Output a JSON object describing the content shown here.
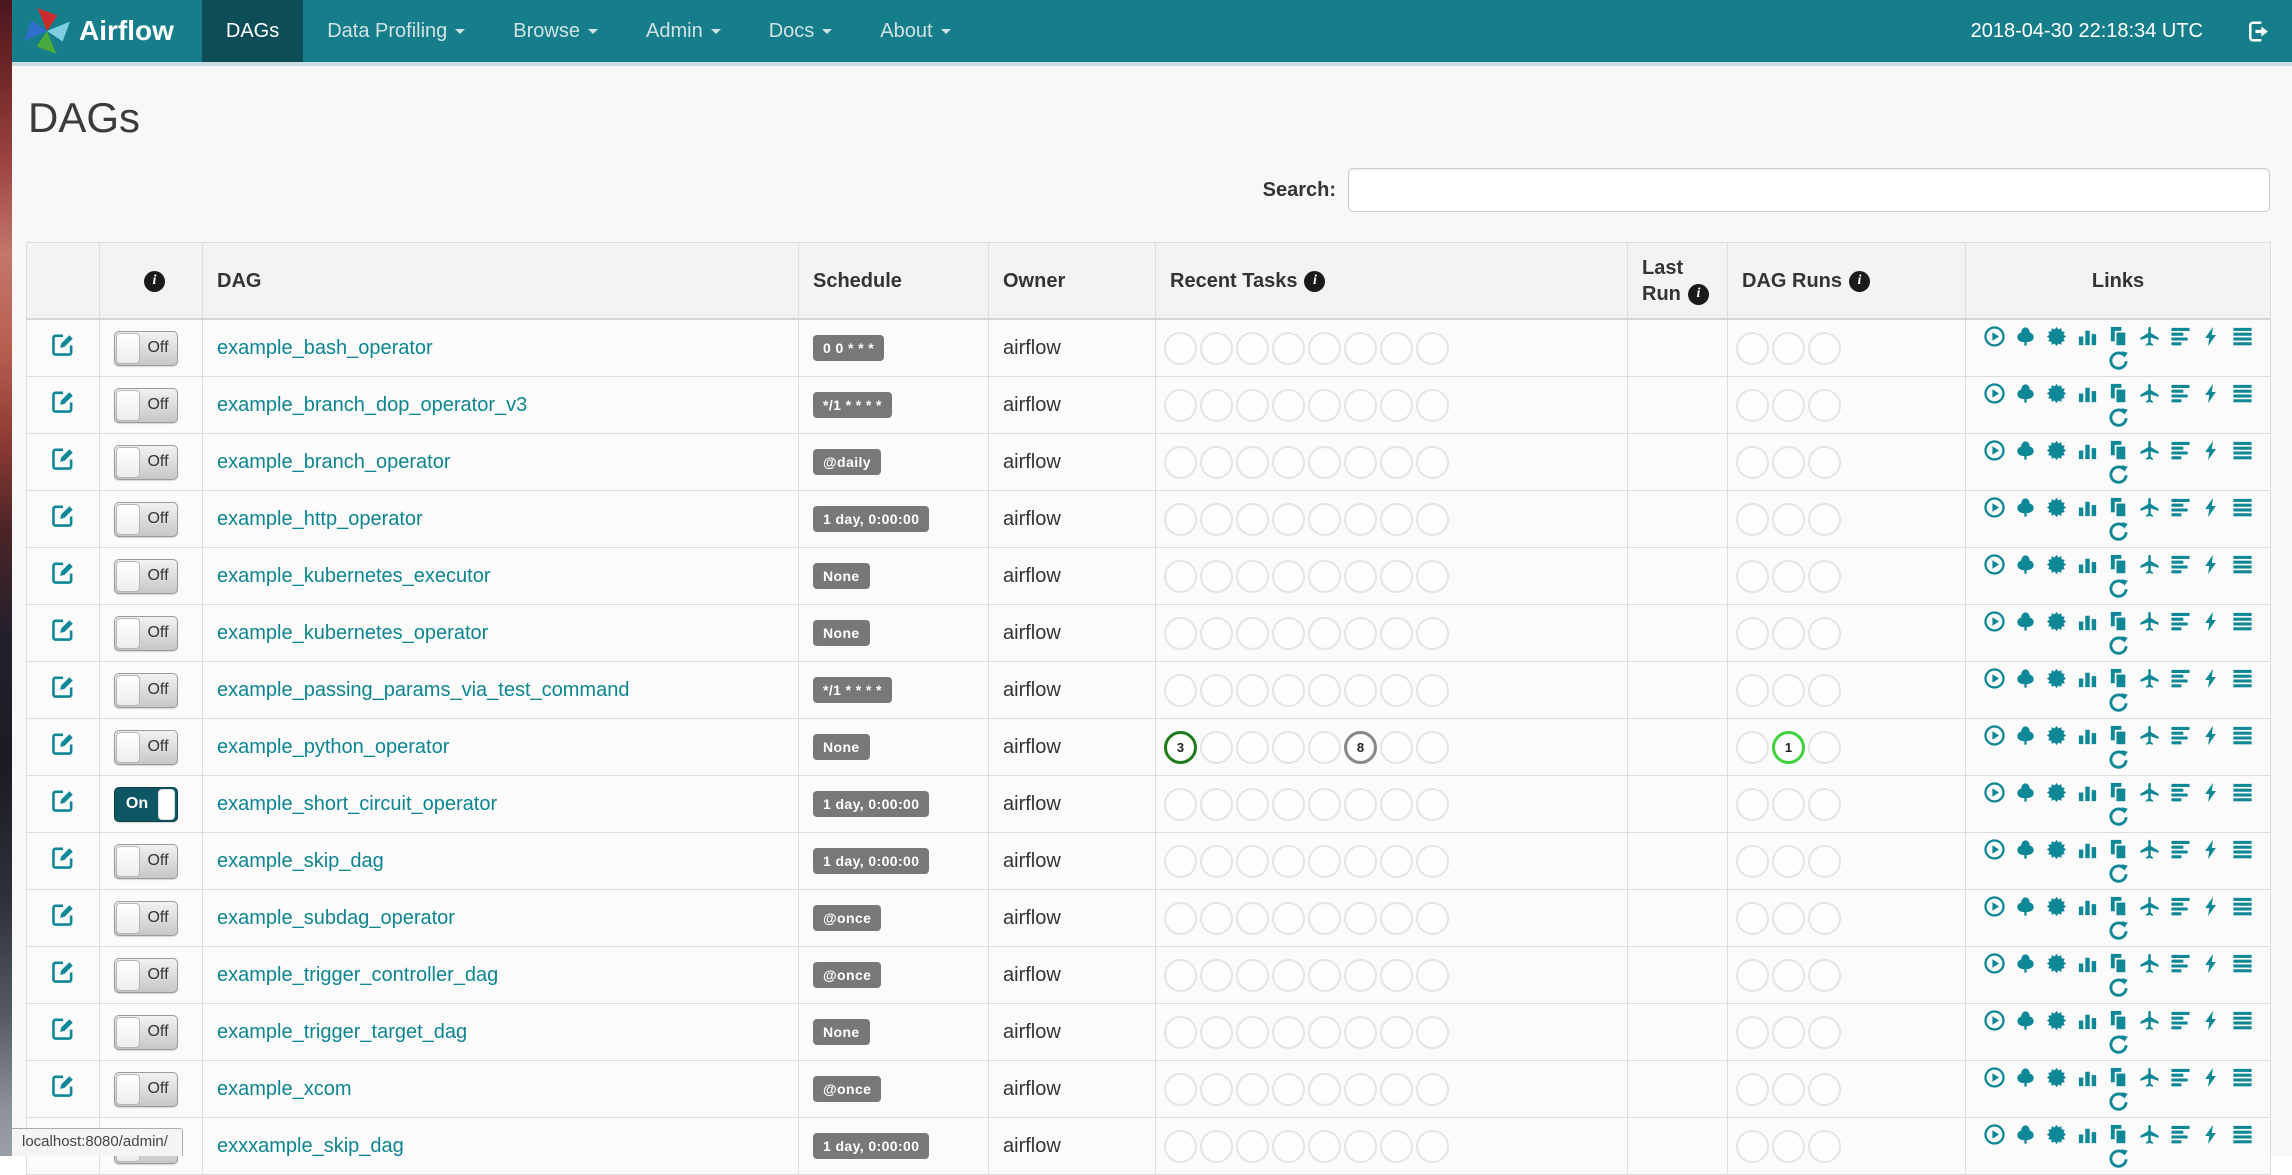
{
  "navbar": {
    "brand": "Airflow",
    "items": [
      {
        "label": "DAGs",
        "active": true,
        "dropdown": false
      },
      {
        "label": "Data Profiling",
        "active": false,
        "dropdown": true
      },
      {
        "label": "Browse",
        "active": false,
        "dropdown": true
      },
      {
        "label": "Admin",
        "active": false,
        "dropdown": true
      },
      {
        "label": "Docs",
        "active": false,
        "dropdown": true
      },
      {
        "label": "About",
        "active": false,
        "dropdown": true
      }
    ],
    "clock": "2018-04-30 22:18:34 UTC"
  },
  "page": {
    "title": "DAGs"
  },
  "search": {
    "label": "Search:",
    "value": ""
  },
  "table": {
    "headers": {
      "dag": "DAG",
      "schedule": "Schedule",
      "owner": "Owner",
      "recent_tasks": "Recent Tasks",
      "last_run": "Last Run",
      "dag_runs": "DAG Runs",
      "links": "Links"
    },
    "recent_task_slots": 8,
    "dag_run_slots": 3,
    "links_icons": [
      "trigger-dag",
      "tree-view",
      "graph-view",
      "task-duration",
      "task-tries",
      "landing-times",
      "gantt-view",
      "code-view",
      "dag-details",
      "refresh"
    ],
    "rows": [
      {
        "dag": "example_bash_operator",
        "schedule": "0 0 * * *",
        "owner": "airflow",
        "toggle": "Off",
        "last_run": "",
        "recent_tasks": [],
        "dag_runs": []
      },
      {
        "dag": "example_branch_dop_operator_v3",
        "schedule": "*/1 * * * *",
        "owner": "airflow",
        "toggle": "Off",
        "last_run": "",
        "recent_tasks": [],
        "dag_runs": []
      },
      {
        "dag": "example_branch_operator",
        "schedule": "@daily",
        "owner": "airflow",
        "toggle": "Off",
        "last_run": "",
        "recent_tasks": [],
        "dag_runs": []
      },
      {
        "dag": "example_http_operator",
        "schedule": "1 day, 0:00:00",
        "owner": "airflow",
        "toggle": "Off",
        "last_run": "",
        "recent_tasks": [],
        "dag_runs": []
      },
      {
        "dag": "example_kubernetes_executor",
        "schedule": "None",
        "owner": "airflow",
        "toggle": "Off",
        "last_run": "",
        "recent_tasks": [],
        "dag_runs": []
      },
      {
        "dag": "example_kubernetes_operator",
        "schedule": "None",
        "owner": "airflow",
        "toggle": "Off",
        "last_run": "",
        "recent_tasks": [],
        "dag_runs": []
      },
      {
        "dag": "example_passing_params_via_test_command",
        "schedule": "*/1 * * * *",
        "owner": "airflow",
        "toggle": "Off",
        "last_run": "",
        "recent_tasks": [],
        "dag_runs": []
      },
      {
        "dag": "example_python_operator",
        "schedule": "None",
        "owner": "airflow",
        "toggle": "Off",
        "last_run": "",
        "recent_tasks": [
          {
            "slot": 0,
            "count": "3",
            "state": "success"
          },
          {
            "slot": 5,
            "count": "8",
            "state": "queued"
          }
        ],
        "dag_runs": [
          {
            "slot": 1,
            "count": "1",
            "state": "running"
          }
        ]
      },
      {
        "dag": "example_short_circuit_operator",
        "schedule": "1 day, 0:00:00",
        "owner": "airflow",
        "toggle": "On",
        "last_run": "",
        "recent_tasks": [],
        "dag_runs": []
      },
      {
        "dag": "example_skip_dag",
        "schedule": "1 day, 0:00:00",
        "owner": "airflow",
        "toggle": "Off",
        "last_run": "",
        "recent_tasks": [],
        "dag_runs": []
      },
      {
        "dag": "example_subdag_operator",
        "schedule": "@once",
        "owner": "airflow",
        "toggle": "Off",
        "last_run": "",
        "recent_tasks": [],
        "dag_runs": []
      },
      {
        "dag": "example_trigger_controller_dag",
        "schedule": "@once",
        "owner": "airflow",
        "toggle": "Off",
        "last_run": "",
        "recent_tasks": [],
        "dag_runs": []
      },
      {
        "dag": "example_trigger_target_dag",
        "schedule": "None",
        "owner": "airflow",
        "toggle": "Off",
        "last_run": "",
        "recent_tasks": [],
        "dag_runs": []
      },
      {
        "dag": "example_xcom",
        "schedule": "@once",
        "owner": "airflow",
        "toggle": "Off",
        "last_run": "",
        "recent_tasks": [],
        "dag_runs": []
      },
      {
        "dag": "exxxample_skip_dag",
        "schedule": "1 day, 0:00:00",
        "owner": "airflow",
        "toggle": "Off",
        "last_run": "",
        "recent_tasks": [],
        "dag_runs": []
      }
    ]
  },
  "status_bar": "localhost:8080/admin/",
  "colors": {
    "navbar_bg": "#167e8a",
    "navbar_active_bg": "#0d4d57",
    "accent_teal": "#0e8796",
    "dag_link": "#0c8591",
    "badge_bg": "#787878",
    "state_success": "#1d7a1d",
    "state_queued": "#878787",
    "state_running": "#3fd23f"
  }
}
